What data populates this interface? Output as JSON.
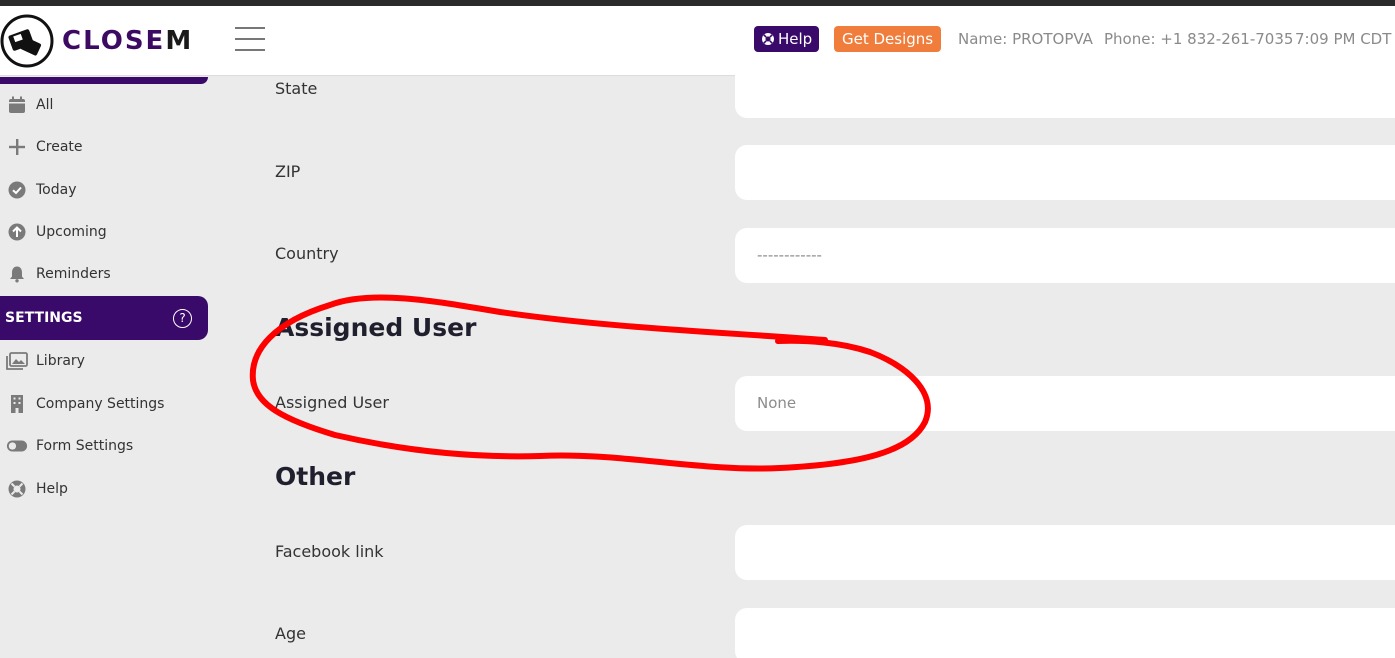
{
  "header": {
    "brand_main": "CLOSE",
    "brand_last": "M",
    "help_label": "Help",
    "designs_label": "Get Designs",
    "name": "Name: PROTOPVA",
    "phone": "Phone: +1 832-261-7035",
    "time": "7:09 PM CDT"
  },
  "sidebar": {
    "items_top": [
      {
        "label": "All",
        "icon": "calendar-icon"
      },
      {
        "label": "Create",
        "icon": "plus-icon"
      },
      {
        "label": "Today",
        "icon": "check-circle-icon"
      },
      {
        "label": "Upcoming",
        "icon": "arrow-up-circle-icon"
      },
      {
        "label": "Reminders",
        "icon": "bell-icon"
      }
    ],
    "settings_label": "SETTINGS",
    "settings_help": "?",
    "items_settings": [
      {
        "label": "Library",
        "icon": "images-icon"
      },
      {
        "label": "Company Settings",
        "icon": "building-icon"
      },
      {
        "label": "Form Settings",
        "icon": "toggle-icon"
      },
      {
        "label": "Help",
        "icon": "lifebuoy-icon"
      }
    ]
  },
  "form": {
    "state_label": "State",
    "state_value": "",
    "zip_label": "ZIP",
    "zip_value": "",
    "country_label": "Country",
    "country_value": "------------",
    "assigned_section": "Assigned User",
    "assigned_label": "Assigned User",
    "assigned_value": "None",
    "other_section": "Other",
    "facebook_label": "Facebook link",
    "facebook_value": "",
    "age_label": "Age",
    "age_value": ""
  },
  "colors": {
    "brand_purple": "#3a0a6b",
    "accent_orange": "#f07d3b",
    "annotation_red": "#ff0000",
    "background": "#ebebeb"
  }
}
